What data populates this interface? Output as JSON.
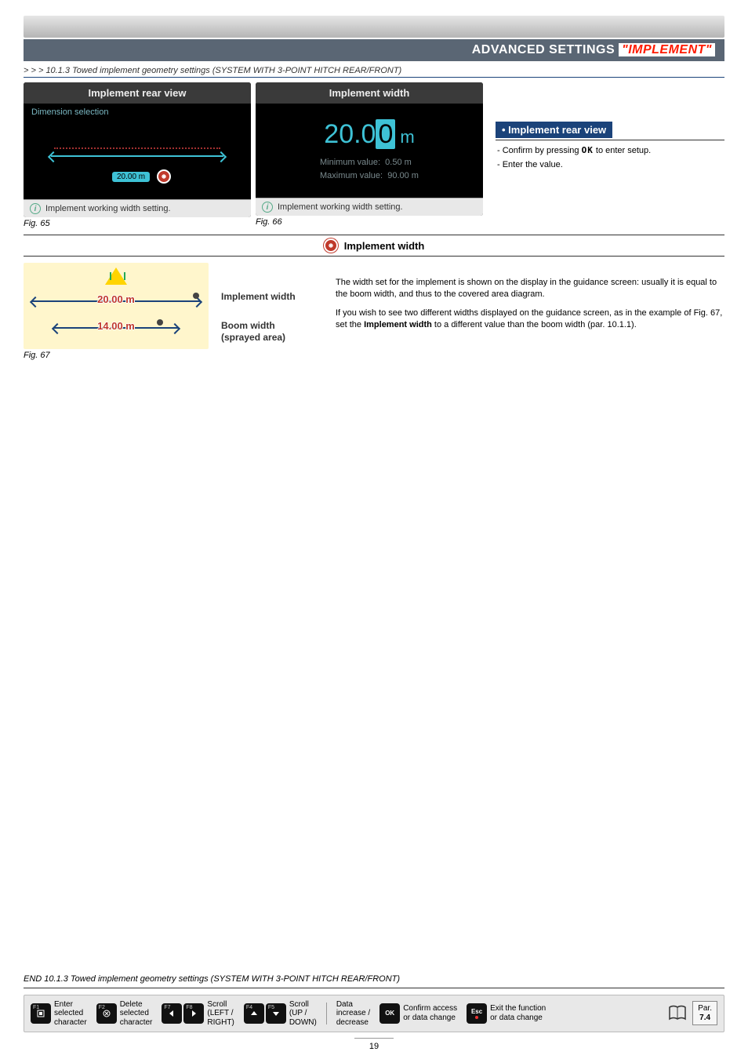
{
  "header": {
    "bar_title_prefix": "ADVANCED SETTINGS ",
    "bar_title_highlight": "\"IMPLEMENT\""
  },
  "breadcrumb": "> > > 10.1.3 Towed implement geometry settings (SYSTEM WITH 3-POINT HITCH REAR/FRONT)",
  "fig65": {
    "title": "Implement rear view",
    "subtitle": "Dimension selection",
    "dim_label": "20.00 m",
    "hint": "Implement working width setting.",
    "caption": "Fig. 65"
  },
  "fig66": {
    "title": "Implement width",
    "value_main": "20.0",
    "value_cursor": "0",
    "value_unit": "m",
    "min_label": "Minimum value:",
    "min_val": "0.50 m",
    "max_label": "Maximum value:",
    "max_val": "90.00 m",
    "hint": "Implement working width setting.",
    "caption": "Fig. 66"
  },
  "right": {
    "heading": "• Implement rear view",
    "line1_a": "- Confirm by pressing ",
    "line1_ok": "OK",
    "line1_b": " to enter setup.",
    "line2": "- Enter the value."
  },
  "iw_header": "Implement width",
  "fig67": {
    "top_label": "20.00 m",
    "bot_label": "14.00 m",
    "legend_top": "Implement width",
    "legend_bot_a": "Boom width",
    "legend_bot_b": "(sprayed area)",
    "caption": "Fig. 67"
  },
  "body": {
    "p1": "The width set for the implement is shown on the display in the guidance screen: usually it is equal to the boom width, and thus to the covered area diagram.",
    "p2_a": "If you wish to see two different widths displayed on the guidance screen, as in the example of Fig. 67, set the ",
    "p2_bold": "Implement width",
    "p2_b": " to a different value than the boom width (par. 10.1.1)."
  },
  "end_line": "END 10.1.3 Towed implement geometry settings (SYSTEM WITH 3-POINT HITCH REAR/FRONT)",
  "footer": {
    "f1": {
      "fn": "F1",
      "label": "Enter\nselected\ncharacter"
    },
    "f2": {
      "fn": "F2",
      "label": "Delete\nselected\ncharacter"
    },
    "f78": {
      "fn_a": "F7",
      "fn_b": "F8",
      "label": "Scroll\n(LEFT /\nRIGHT)"
    },
    "f45": {
      "fn_a": "F4",
      "fn_b": "F5",
      "label": "Scroll\n(UP /\nDOWN)"
    },
    "data": "Data\nincrease /\ndecrease",
    "ok": {
      "key": "OK",
      "label": "Confirm access\nor data change"
    },
    "esc": {
      "key": "Esc",
      "label": "Exit the function\nor data change"
    },
    "par_label": "Par.",
    "par_val": "7.4"
  },
  "page_number": "19"
}
